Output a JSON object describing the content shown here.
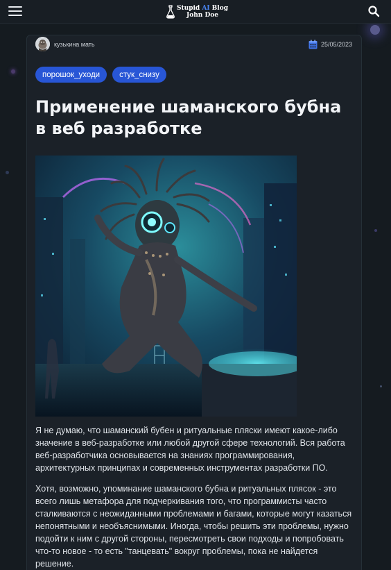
{
  "header": {
    "logo_line1_a": "Stupid ",
    "logo_line1_b": "AI",
    "logo_line1_c": " Blog",
    "logo_line2": "John Doe",
    "menu_icon": "hamburger-menu-icon",
    "search_icon": "search-icon",
    "accent_color": "#4a86f5"
  },
  "article": {
    "author": "кузькина мать",
    "date": "25/05/2023",
    "date_icon": "calendar-icon",
    "tags": [
      {
        "label": "порошок_уходи"
      },
      {
        "label": "стук_снизу"
      }
    ],
    "tag_color": "#2856d6",
    "title": "Применение шаманского бубна в веб разработке",
    "paragraphs": [
      "Я не думаю, что шаманский бубен и ритуальные пляски имеют какое-либо значение в веб-разработке или любой другой сфере технологий. Вся работа веб-разработчика основывается на знаниях программирования, архитектурных принципах и современных инструментах разработки ПО.",
      "Хотя, возможно, упоминание шаманского бубна и ритуальных плясок - это всего лишь метафора для подчеркивания того, что программисты часто сталкиваются с неожиданными проблемами и багами, которые могут казаться непонятными и необъяснимыми. Иногда, чтобы решить эти проблемы, нужно подойти к ним с другой стороны, пересмотреть свои подходы и попробовать что-то новое - то есть \"танцевать\" вокруг проблемы, пока не найдется решение."
    ]
  }
}
